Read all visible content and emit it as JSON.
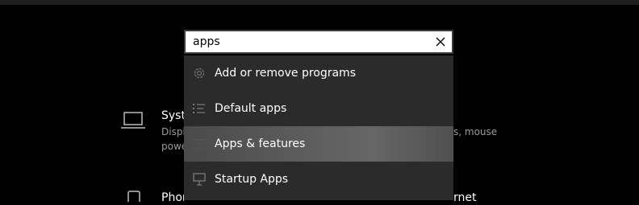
{
  "search": {
    "value": "apps",
    "clear_label": "×"
  },
  "results": [
    {
      "label": "Add or remove programs",
      "icon": "gear-icon"
    },
    {
      "label": "Default apps",
      "icon": "default-apps-icon"
    },
    {
      "label": "Apps & features",
      "icon": "apps-features-icon"
    },
    {
      "label": "Startup Apps",
      "icon": "startup-apps-icon"
    }
  ],
  "background": {
    "system": {
      "title": "Syste",
      "desc_line1": "Displ",
      "desc_line1_right": "s, mouse",
      "desc_line2": "powe",
      "icon": "laptop-icon"
    },
    "phone": {
      "title": "Phon",
      "title_right": "rnet",
      "icon": "phone-icon"
    }
  },
  "colors": {
    "background": "#000000",
    "dropdown": "#2b2b2b",
    "highlight": "#5d5d5d",
    "search_border": "#3b3b3b"
  }
}
